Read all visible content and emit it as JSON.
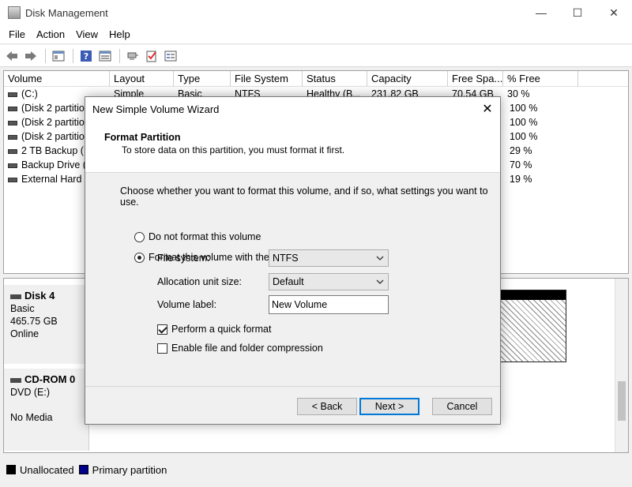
{
  "window": {
    "title": "Disk Management",
    "minimize": "—",
    "maximize": "☐",
    "close": "✕"
  },
  "menu": [
    "File",
    "Action",
    "View",
    "Help"
  ],
  "volume_list": {
    "columns": [
      "Volume",
      "Layout",
      "Type",
      "File System",
      "Status",
      "Capacity",
      "Free Spa...",
      "% Free"
    ],
    "rows": [
      {
        "volume": "(C:)",
        "layout": "Simple",
        "type": "Basic",
        "fs": "NTFS",
        "status": "Healthy (B...",
        "capacity": "231.82 GB",
        "free": "70.54 GB",
        "pct": "30 %"
      },
      {
        "volume": "(Disk 2 partition",
        "layout": "",
        "type": "",
        "fs": "",
        "status": "",
        "capacity": "",
        "free": "",
        "pct": "100 %"
      },
      {
        "volume": "(Disk 2 partition",
        "layout": "",
        "type": "",
        "fs": "",
        "status": "",
        "capacity": "",
        "free": "",
        "pct": "100 %"
      },
      {
        "volume": "(Disk 2 partition",
        "layout": "",
        "type": "",
        "fs": "",
        "status": "",
        "capacity": "",
        "free": "",
        "pct": "100 %"
      },
      {
        "volume": "2 TB Backup (F",
        "layout": "",
        "type": "",
        "fs": "",
        "status": "",
        "capacity": "",
        "free": "",
        "pct": "29 %"
      },
      {
        "volume": "Backup Drive (",
        "layout": "",
        "type": "",
        "fs": "",
        "status": "",
        "capacity": "",
        "free": "",
        "pct": "70 %"
      },
      {
        "volume": "External Hard D",
        "layout": "",
        "type": "",
        "fs": "",
        "status": "",
        "capacity": "",
        "free": "",
        "pct": "19 %"
      }
    ]
  },
  "disks": [
    {
      "name": "Disk 4",
      "type": "Basic",
      "size": "465.75 GB",
      "status": "Online"
    },
    {
      "name": "CD-ROM 0",
      "type": "DVD (E:)",
      "size": "",
      "status": "No Media"
    }
  ],
  "legend": [
    {
      "label": "Unallocated",
      "color": "#000000"
    },
    {
      "label": "Primary partition",
      "color": "#00008b"
    }
  ],
  "dialog": {
    "title": "New Simple Volume Wizard",
    "close": "✕",
    "header_title": "Format Partition",
    "header_subtitle": "To store data on this partition, you must format it first.",
    "instructions": "Choose whether you want to format this volume, and if so, what settings you want to use.",
    "option_no_format": "Do not format this volume",
    "option_format": "Format this volume with the following settings:",
    "file_system_label": "File system:",
    "file_system_value": "NTFS",
    "alloc_label": "Allocation unit size:",
    "alloc_value": "Default",
    "volume_label_label": "Volume label:",
    "volume_label_value": "New Volume",
    "quick_format_label": "Perform a quick format",
    "quick_format_checked": true,
    "compression_label": "Enable file and folder compression",
    "compression_checked": false,
    "back_button": "< Back",
    "next_button": "Next >",
    "cancel_button": "Cancel"
  }
}
